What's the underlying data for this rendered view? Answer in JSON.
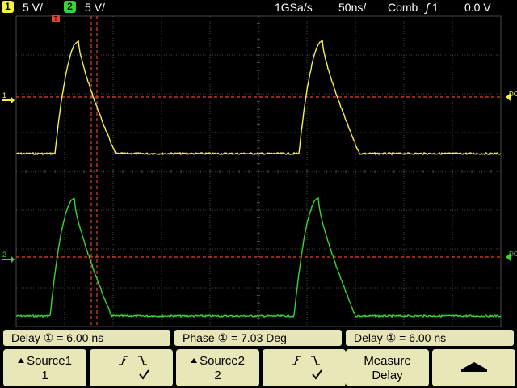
{
  "status": {
    "ch1": {
      "badge": "1",
      "scale": "5 V/",
      "color": "#f4f24a"
    },
    "ch2": {
      "badge": "2",
      "scale": "5 V/",
      "color": "#37d634"
    },
    "sample_rate": "1GSa/s",
    "timebase": "50ns/",
    "trigger_mode": "Comb",
    "trigger_source": "1",
    "trigger_level": "0.0 V"
  },
  "markers": {
    "trigger": "T",
    "ch1_ground": "1",
    "ch2_ground": "2",
    "ch1_coupling": "DC",
    "ch2_coupling": "DC"
  },
  "measurements": [
    {
      "label": "Delay",
      "source": "①",
      "value": "6.00 ns"
    },
    {
      "label": "Phase",
      "source": "①",
      "value": "7.03 Deg"
    },
    {
      "label": "Delay",
      "source": "①",
      "value": "6.00 ns"
    }
  ],
  "softkeys": {
    "source1": {
      "label": "Source1",
      "value": "1"
    },
    "edge1": {
      "rise_icon": "rising-edge-icon",
      "fall_icon": "falling-edge-icon",
      "check_icon": "checkmark-icon"
    },
    "source2": {
      "label": "Source2",
      "value": "2"
    },
    "edge2": {
      "rise_icon": "rising-edge-icon",
      "fall_icon": "falling-edge-icon",
      "check_icon": "checkmark-icon"
    },
    "measure": {
      "line1": "Measure",
      "line2": "Delay"
    },
    "back": {
      "icon": "up-arrow-icon"
    }
  },
  "colors": {
    "grid": "#5a5a5a",
    "cursor": "#e0442e",
    "softkey_bg": "#e8e7b7"
  }
}
